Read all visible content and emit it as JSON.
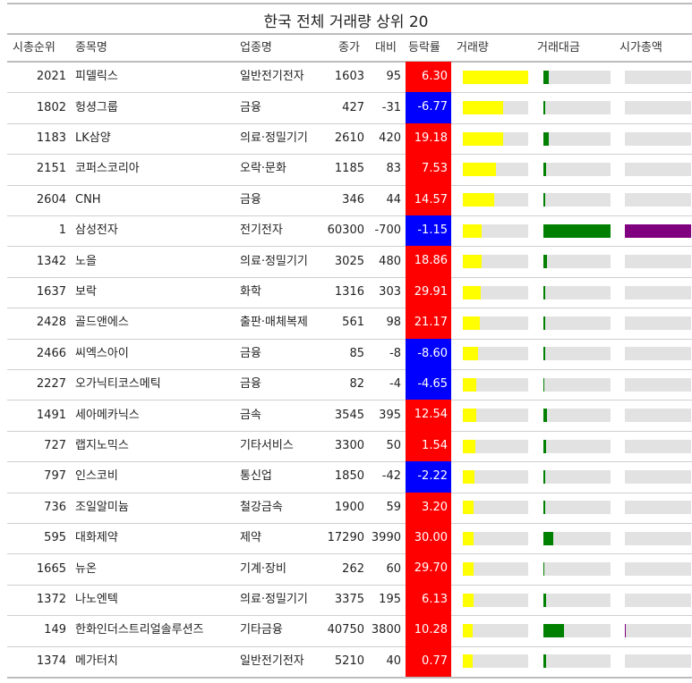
{
  "chart_data": {
    "type": "table",
    "title": "한국 전체 거래량 상위 20",
    "columns": [
      "시총순위",
      "종목명",
      "업종명",
      "종가",
      "대비",
      "등락률",
      "거래량",
      "거래대금",
      "시가총액"
    ],
    "colors": {
      "up": "#ff0000",
      "down": "#0000ff",
      "volume": "#ffff00",
      "value": "#008000",
      "marketcap": "#800080",
      "track": "#e2e2e2"
    },
    "rows": [
      {
        "rank": "2021",
        "name": "피델릭스",
        "sector": "일반전기전자",
        "close": "1603",
        "change": "95",
        "rate": "6.30",
        "volume": 1.0,
        "amount": 0.08,
        "mcap": 0.0
      },
      {
        "rank": "1802",
        "name": "헝셩그룹",
        "sector": "금융",
        "close": "427",
        "change": "-31",
        "rate": "-6.77",
        "volume": 0.62,
        "amount": 0.02,
        "mcap": 0.0
      },
      {
        "rank": "1183",
        "name": "LK삼양",
        "sector": "의료·정밀기기",
        "close": "2610",
        "change": "420",
        "rate": "19.18",
        "volume": 0.61,
        "amount": 0.08,
        "mcap": 0.0
      },
      {
        "rank": "2151",
        "name": "코퍼스코리아",
        "sector": "오락·문화",
        "close": "1185",
        "change": "83",
        "rate": "7.53",
        "volume": 0.5,
        "amount": 0.04,
        "mcap": 0.0
      },
      {
        "rank": "2604",
        "name": "CNH",
        "sector": "금융",
        "close": "346",
        "change": "44",
        "rate": "14.57",
        "volume": 0.48,
        "amount": 0.02,
        "mcap": 0.0
      },
      {
        "rank": "1",
        "name": "삼성전자",
        "sector": "전기전자",
        "close": "60300",
        "change": "-700",
        "rate": "-1.15",
        "volume": 0.29,
        "amount": 1.0,
        "mcap": 1.0
      },
      {
        "rank": "1342",
        "name": "노을",
        "sector": "의료·정밀기기",
        "close": "3025",
        "change": "480",
        "rate": "18.86",
        "volume": 0.29,
        "amount": 0.05,
        "mcap": 0.0
      },
      {
        "rank": "1637",
        "name": "보락",
        "sector": "화학",
        "close": "1316",
        "change": "303",
        "rate": "29.91",
        "volume": 0.28,
        "amount": 0.02,
        "mcap": 0.0
      },
      {
        "rank": "2428",
        "name": "골드앤에스",
        "sector": "출판·매체복제",
        "close": "561",
        "change": "98",
        "rate": "21.17",
        "volume": 0.26,
        "amount": 0.02,
        "mcap": 0.0
      },
      {
        "rank": "2466",
        "name": "씨엑스아이",
        "sector": "금융",
        "close": "85",
        "change": "-8",
        "rate": "-8.60",
        "volume": 0.23,
        "amount": 0.02,
        "mcap": 0.0
      },
      {
        "rank": "2227",
        "name": "오가닉티코스메틱",
        "sector": "금융",
        "close": "82",
        "change": "-4",
        "rate": "-4.65",
        "volume": 0.2,
        "amount": 0.01,
        "mcap": 0.0
      },
      {
        "rank": "1491",
        "name": "세아메카닉스",
        "sector": "금속",
        "close": "3545",
        "change": "395",
        "rate": "12.54",
        "volume": 0.2,
        "amount": 0.05,
        "mcap": 0.0
      },
      {
        "rank": "727",
        "name": "랩지노믹스",
        "sector": "기타서비스",
        "close": "3300",
        "change": "50",
        "rate": "1.54",
        "volume": 0.19,
        "amount": 0.04,
        "mcap": 0.0
      },
      {
        "rank": "797",
        "name": "인스코비",
        "sector": "통신업",
        "close": "1850",
        "change": "-42",
        "rate": "-2.22",
        "volume": 0.18,
        "amount": 0.02,
        "mcap": 0.0
      },
      {
        "rank": "736",
        "name": "조일알미늄",
        "sector": "철강금속",
        "close": "1900",
        "change": "59",
        "rate": "3.20",
        "volume": 0.17,
        "amount": 0.02,
        "mcap": 0.0
      },
      {
        "rank": "595",
        "name": "대화제약",
        "sector": "제약",
        "close": "17290",
        "change": "3990",
        "rate": "30.00",
        "volume": 0.16,
        "amount": 0.14,
        "mcap": 0.0
      },
      {
        "rank": "1665",
        "name": "뉴온",
        "sector": "기계·장비",
        "close": "262",
        "change": "60",
        "rate": "29.70",
        "volume": 0.16,
        "amount": 0.01,
        "mcap": 0.0
      },
      {
        "rank": "1372",
        "name": "나노엔텍",
        "sector": "의료·정밀기기",
        "close": "3375",
        "change": "195",
        "rate": "6.13",
        "volume": 0.16,
        "amount": 0.04,
        "mcap": 0.0
      },
      {
        "rank": "149",
        "name": "한화인더스트리얼솔루션즈",
        "sector": "기타금융",
        "close": "40750",
        "change": "3800",
        "rate": "10.28",
        "volume": 0.15,
        "amount": 0.3,
        "mcap": 0.01
      },
      {
        "rank": "1374",
        "name": "메가터치",
        "sector": "일반전기전자",
        "close": "5210",
        "change": "40",
        "rate": "0.77",
        "volume": 0.15,
        "amount": 0.04,
        "mcap": 0.0
      }
    ]
  }
}
